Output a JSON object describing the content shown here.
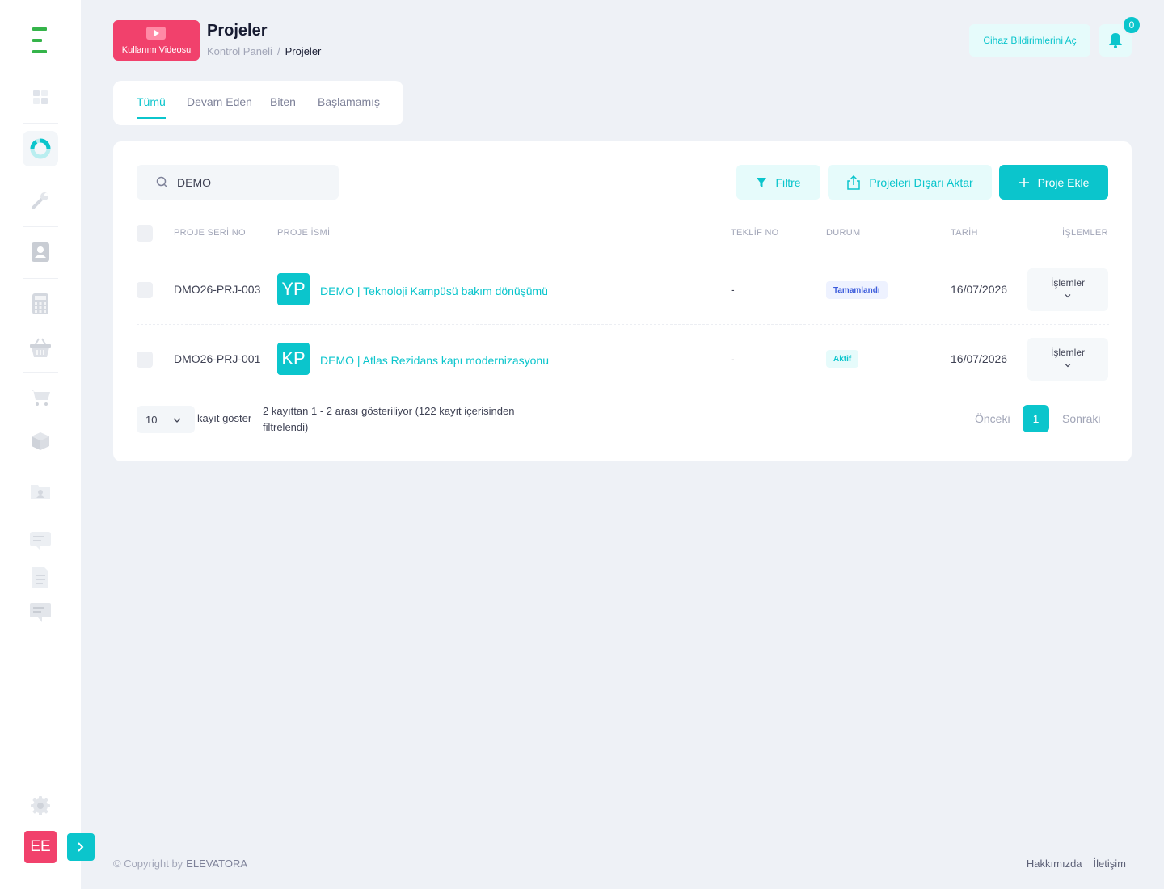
{
  "header": {
    "video_label": "Kullanım Videosu",
    "title": "Projeler",
    "breadcrumb": {
      "home": "Kontrol Paneli",
      "separator": "/",
      "current": "Projeler"
    },
    "notif_button": "Cihaz Bildirimlerini Aç",
    "bell_count": "0"
  },
  "tabs": [
    "Tümü",
    "Devam Eden",
    "Biten",
    "Başlamamış"
  ],
  "toolbar": {
    "search_value": "DEMO",
    "filter_label": "Filtre",
    "export_label": "Projeleri Dışarı Aktar",
    "add_label": "Proje Ekle"
  },
  "table": {
    "columns": [
      "PROJE SERİ NO",
      "PROJE İSMİ",
      "TEKLİF NO",
      "DURUM",
      "TARİH",
      "İŞLEMLER"
    ],
    "rows": [
      {
        "serial": "DMO26-PRJ-003",
        "initials": "YP",
        "name": "DEMO | Teknoloji Kampüsü bakım dönüşümü",
        "offer_no": "-",
        "status": "Tamamlandı",
        "date": "16/07/2026",
        "ops": "İşlemler"
      },
      {
        "serial": "DMO26-PRJ-001",
        "initials": "KP",
        "name": "DEMO | Atlas Rezidans kapı modernizasyonu",
        "offer_no": "-",
        "status": "Aktif",
        "date": "16/07/2026",
        "ops": "İşlemler"
      }
    ]
  },
  "pagination": {
    "per_page": "10",
    "per_page_label": "kayıt göster",
    "info": "2 kayıttan 1 - 2 arası gösteriliyor (122 kayıt içerisinden filtrelendi)",
    "prev": "Önceki",
    "current": "1",
    "next": "Sonraki"
  },
  "sidebar": {
    "avatar": "EE"
  },
  "footer": {
    "copyright": "© Copyright by",
    "brand": "ELEVATORA",
    "links": [
      "Hakkımızda",
      "İletişim"
    ]
  },
  "colors": {
    "accent": "#0bc5cc",
    "danger": "#f1416c",
    "logo": "#35b44a"
  }
}
